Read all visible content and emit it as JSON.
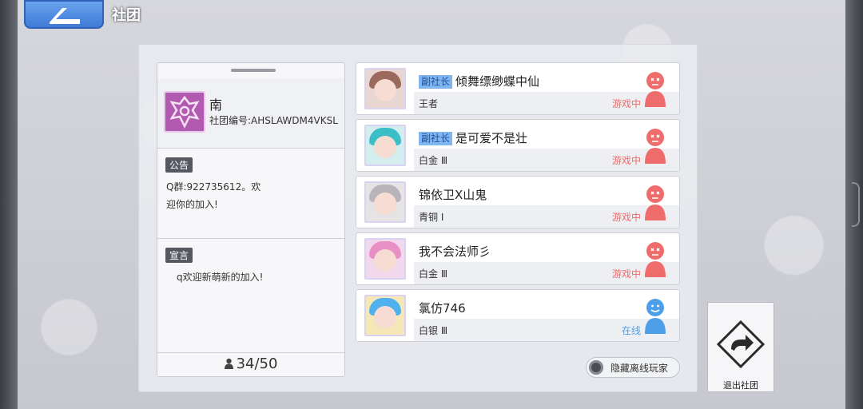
{
  "header": {
    "title": "社团",
    "back_icon": "back-arrow-icon"
  },
  "club": {
    "name": "南",
    "id_text": "社团编号:AHSLAWDM4VKSL",
    "announcement_tag": "公告",
    "announcement_text": "Q群:922735612。欢迎你的加入!",
    "declaration_tag": "宣言",
    "declaration_text": "q欢迎新萌新的加入!",
    "members_count": "34/50",
    "accent_color": "#b25ab0"
  },
  "members": [
    {
      "role": "副社长",
      "name": "倾舞缥缈蝶中仙",
      "rank": "王者",
      "status": "游戏中",
      "state": "ingame"
    },
    {
      "role": "副社长",
      "name": "是可爱不是壮",
      "rank": "白金 Ⅲ",
      "status": "游戏中",
      "state": "ingame"
    },
    {
      "role": "",
      "name": "锦依卫X山鬼",
      "rank": "青铜 Ⅰ",
      "status": "游戏中",
      "state": "ingame"
    },
    {
      "role": "",
      "name": "我不会法师彡",
      "rank": "白金 Ⅲ",
      "status": "游戏中",
      "state": "ingame"
    },
    {
      "role": "",
      "name": "氯仿746",
      "rank": "白银 Ⅲ",
      "status": "在线",
      "state": "online"
    }
  ],
  "controls": {
    "hide_offline_label": "隐藏离线玩家",
    "exit_label": "退出社团"
  },
  "colors": {
    "ingame": "#ee6c6c",
    "online": "#4da0e8",
    "role_badge": "#7fb6f0"
  }
}
